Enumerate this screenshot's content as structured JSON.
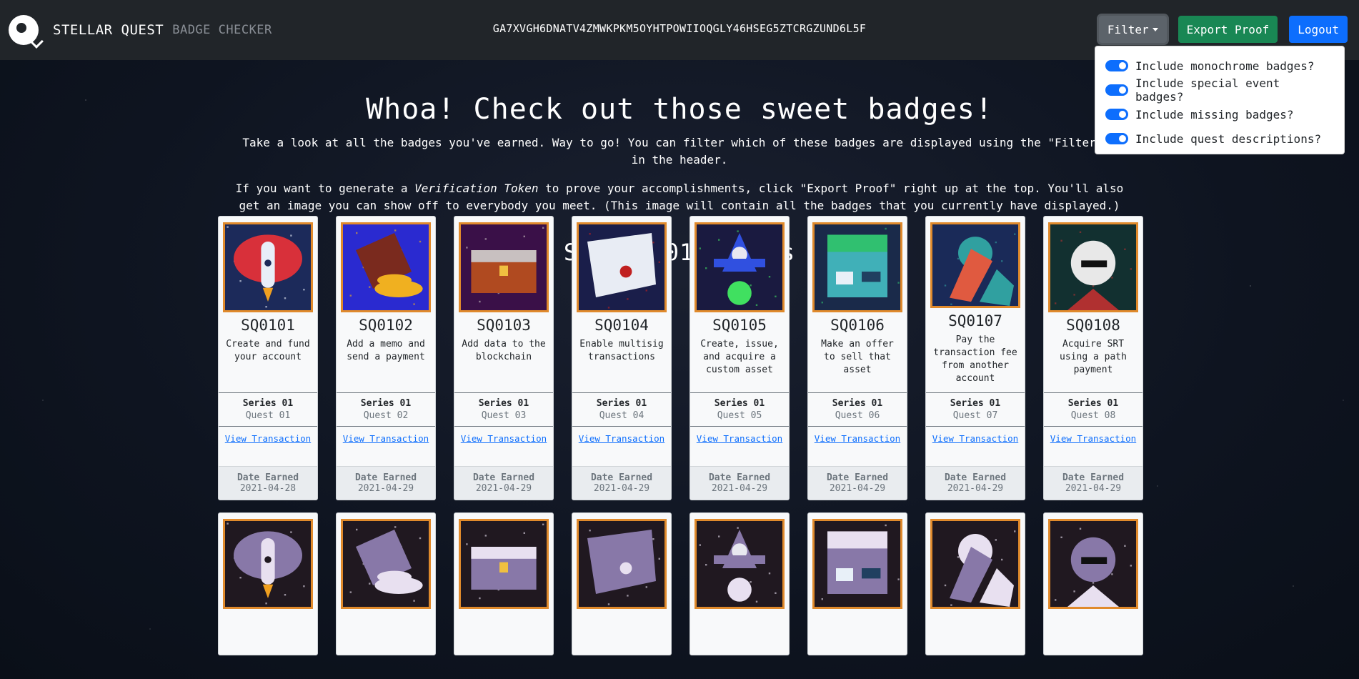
{
  "navbar": {
    "brand_main": "STELLAR QUEST",
    "brand_sub": "BADGE CHECKER",
    "address": "GA7XVGH6DNATV4ZMWKPKM5OYHTPOWIIOQGLY46HSEG5ZTCRGZUND6L5F",
    "filter_label": "Filter",
    "export_label": "Export Proof",
    "logout_label": "Logout",
    "colors": {
      "bg": "#212529",
      "filter": "#5c636a",
      "export": "#198754",
      "logout": "#0d6efd"
    }
  },
  "filter_menu": {
    "items": [
      {
        "label": "Include monochrome badges?",
        "checked": true
      },
      {
        "label": "Include special event badges?",
        "checked": true
      },
      {
        "label": "Include missing badges?",
        "checked": true
      },
      {
        "label": "Include quest descriptions?",
        "checked": true
      }
    ]
  },
  "main": {
    "heading": "Whoa! Check out those sweet badges!",
    "intro_1": "Take a look at all the badges you've earned. Way to go! You can filter which of these badges are displayed using the \"Filter\" o",
    "intro_1b": "in the header.",
    "intro_2_pre": "If you want to generate a ",
    "intro_2_em": "Verification Token",
    "intro_2_post": " to prove your accomplishments, click \"Export Proof\" right up at the top. You'll also get an image you can show off to everybody you meet. (This image will contain all the badges that you currently have displayed.)",
    "series_heading": "Series 01 Badges"
  },
  "labels": {
    "view_tx": "View Transaction",
    "date_earned": "Date Earned"
  },
  "badges": [
    {
      "code": "SQ0101",
      "desc": "Create and fund your account",
      "series": "Series 01",
      "quest": "Quest 01",
      "date": "2021-04-28",
      "icon": "rocket-icon"
    },
    {
      "code": "SQ0102",
      "desc": "Add a memo and send a payment",
      "series": "Series 01",
      "quest": "Quest 02",
      "date": "2021-04-29",
      "icon": "book-coins-icon"
    },
    {
      "code": "SQ0103",
      "desc": "Add data to the blockchain",
      "series": "Series 01",
      "quest": "Quest 03",
      "date": "2021-04-29",
      "icon": "treasure-chest-icon"
    },
    {
      "code": "SQ0104",
      "desc": "Enable multisig transactions",
      "series": "Series 01",
      "quest": "Quest 04",
      "date": "2021-04-29",
      "icon": "scroll-icon"
    },
    {
      "code": "SQ0105",
      "desc": "Create, issue, and acquire a custom asset",
      "series": "Series 01",
      "quest": "Quest 05",
      "date": "2021-04-29",
      "icon": "wizard-icon"
    },
    {
      "code": "SQ0106",
      "desc": "Make an offer to sell that asset",
      "series": "Series 01",
      "quest": "Quest 06",
      "date": "2021-04-29",
      "icon": "market-stall-icon"
    },
    {
      "code": "SQ0107",
      "desc": "Pay the transaction fee from another account",
      "series": "Series 01",
      "quest": "Quest 07",
      "date": "2021-04-29",
      "icon": "strongman-icon"
    },
    {
      "code": "SQ0108",
      "desc": "Acquire SRT using a path payment",
      "series": "Series 01",
      "quest": "Quest 08",
      "date": "2021-04-29",
      "icon": "gentleman-icon"
    }
  ],
  "monochrome_badges": [
    {
      "icon": "rocket-mono-icon"
    },
    {
      "icon": "book-coins-mono-icon"
    },
    {
      "icon": "treasure-chest-mono-icon"
    },
    {
      "icon": "scroll-mono-icon"
    },
    {
      "icon": "wizard-mono-icon"
    },
    {
      "icon": "market-stall-mono-icon"
    },
    {
      "icon": "strongman-mono-icon"
    },
    {
      "icon": "gentleman-mono-icon"
    }
  ],
  "badge_palettes": [
    {
      "bg": "#1c2a5a",
      "fg": "#d8303a",
      "ac": "#e8eef8"
    },
    {
      "bg": "#2a2ad0",
      "fg": "#7a2a1e",
      "ac": "#f0b020"
    },
    {
      "bg": "#3a1048",
      "fg": "#b04a20",
      "ac": "#c8c0c0"
    },
    {
      "bg": "#1a1e4a",
      "fg": "#e8ecf4",
      "ac": "#c02020"
    },
    {
      "bg": "#1a1a40",
      "fg": "#3050e0",
      "ac": "#40e060"
    },
    {
      "bg": "#1a2a4a",
      "fg": "#40b0b8",
      "ac": "#30c070"
    },
    {
      "bg": "#1a2a58",
      "fg": "#e05a40",
      "ac": "#30a0a0"
    },
    {
      "bg": "#123030",
      "fg": "#e8e8e8",
      "ac": "#b03030"
    }
  ],
  "mono_palette": {
    "bg": "#201820",
    "fg": "#8878a8",
    "ac": "#e8e0f0"
  }
}
